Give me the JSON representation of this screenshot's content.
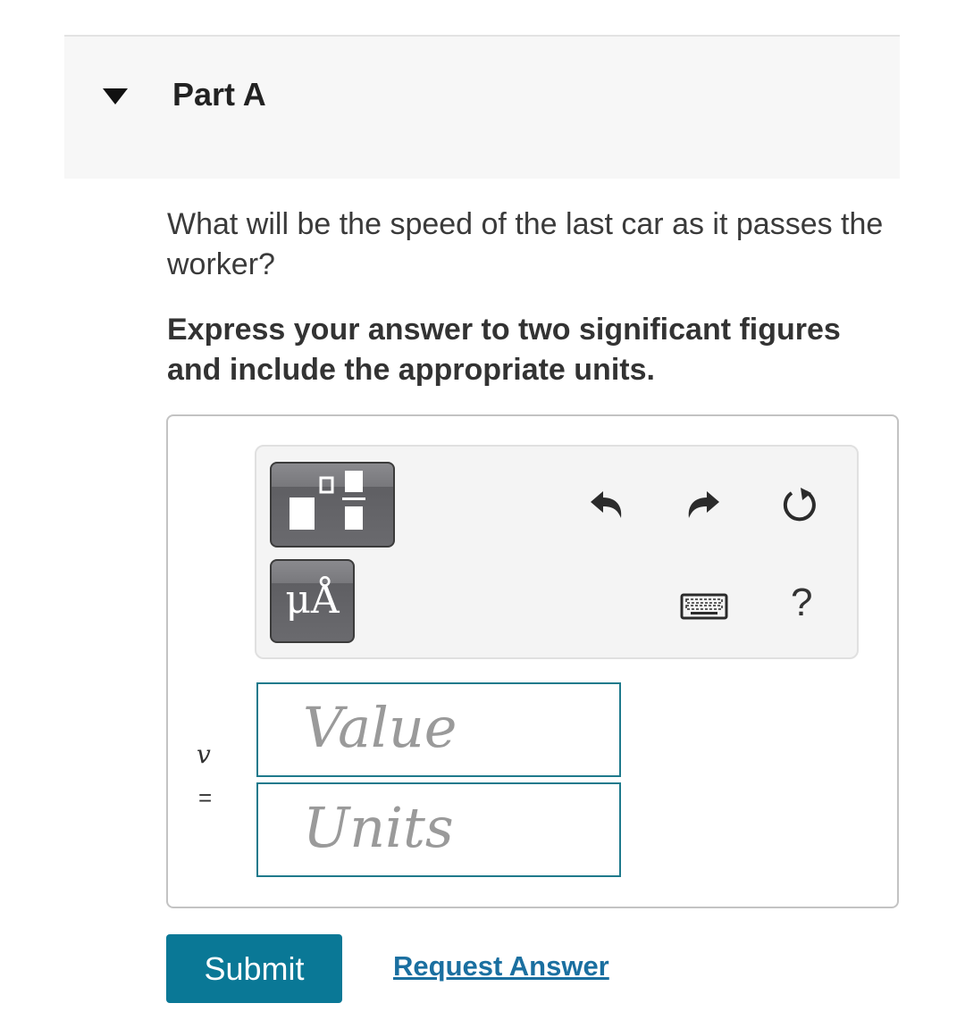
{
  "part": {
    "title": "Part A"
  },
  "question": {
    "text": "What will be the speed of the last car as it passes the worker?",
    "instructions": "Express your answer to two significant figures and include the appropriate units."
  },
  "toolbar": {
    "symbols_label": "μÅ",
    "help_label": "?"
  },
  "answer": {
    "variable": "v",
    "equals": "=",
    "value_placeholder": "Value",
    "units_placeholder": "Units"
  },
  "actions": {
    "submit_label": "Submit",
    "request_label": "Request Answer"
  },
  "colors": {
    "accent": "#0a7896",
    "field_border": "#1f7a8c",
    "link": "#1a6fa0"
  }
}
